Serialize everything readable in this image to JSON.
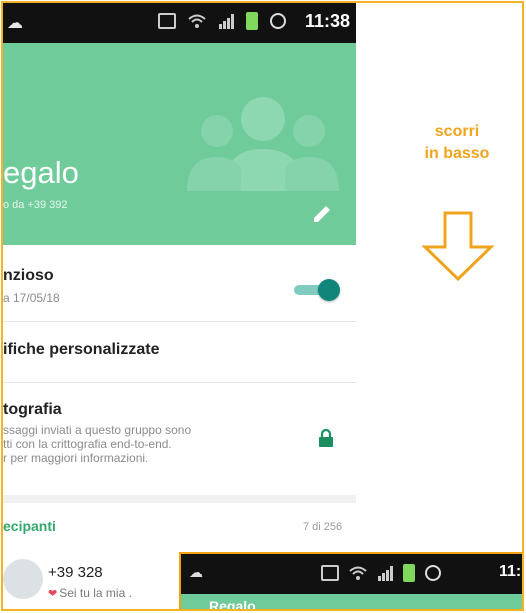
{
  "phone": {
    "status_bar": {
      "time": "11:38"
    },
    "header": {
      "title": "egalo",
      "subtitle": "o da +39 392",
      "color": "#6fcb9a"
    },
    "settings": [
      {
        "title": "nzioso",
        "subtitle": "a 17/05/18"
      },
      {
        "title": "ifiche personalizzate"
      },
      {
        "title": "tografia",
        "lines": [
          "ssaggi inviati a questo gruppo sono",
          "tti con la crittografia end-to-end.",
          "r per maggiori informazioni."
        ]
      }
    ],
    "participants": {
      "label": "ecipanti",
      "count": "7 di 256",
      "items": [
        {
          "name": "+39 328",
          "status": "Sei tu la mia ."
        }
      ]
    }
  },
  "hint": {
    "line1": "scorri",
    "line2": "in basso",
    "color": "#f0a41d"
  },
  "phone2": {
    "status_bar": {
      "time": "11:"
    },
    "title": "Regalo"
  }
}
